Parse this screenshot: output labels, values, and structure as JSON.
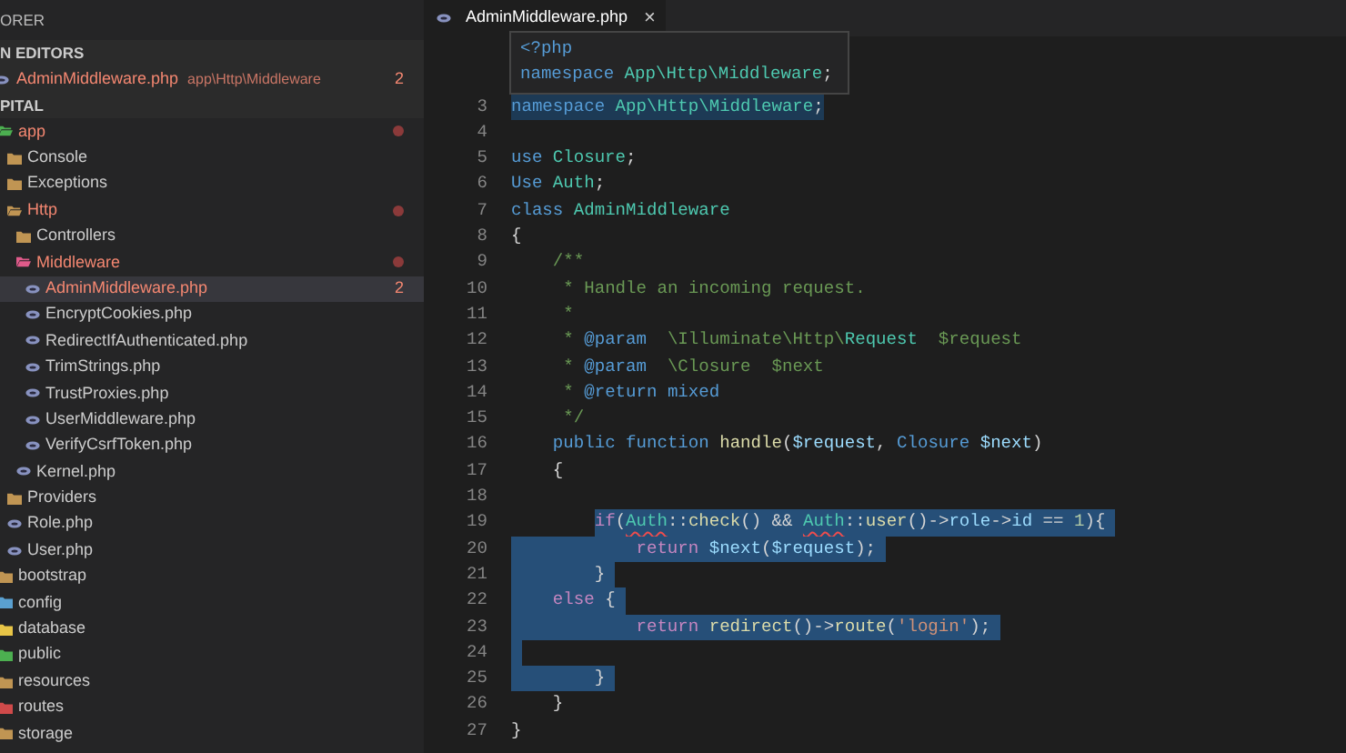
{
  "sidebar": {
    "header": "ORER",
    "open_editors": {
      "title": "N EDITORS",
      "items": [
        {
          "label": "AdminMiddleware.php",
          "path": "app\\Http\\Middleware",
          "badge": "2",
          "error": true
        }
      ]
    },
    "project": {
      "title": "PITAL",
      "tree": [
        {
          "label": "app",
          "kind": "folder",
          "color": "#4caf50",
          "expanded": true,
          "selected": false,
          "error": true,
          "dot": true,
          "children": [
            {
              "label": "Console",
              "kind": "folder",
              "color": "#c09553",
              "expanded": false,
              "selected": false,
              "error": false,
              "dot": false
            },
            {
              "label": "Exceptions",
              "kind": "folder",
              "color": "#c09553",
              "expanded": false,
              "selected": false,
              "error": false,
              "dot": false
            },
            {
              "label": "Http",
              "kind": "folder",
              "color": "#c09553",
              "expanded": true,
              "selected": false,
              "error": true,
              "dot": true,
              "children": [
                {
                  "label": "Controllers",
                  "kind": "folder",
                  "color": "#c09553",
                  "expanded": false,
                  "selected": false,
                  "error": false,
                  "dot": false
                },
                {
                  "label": "Middleware",
                  "kind": "folder",
                  "color": "#e05a8a",
                  "expanded": true,
                  "selected": false,
                  "error": true,
                  "dot": true,
                  "children": [
                    {
                      "label": "AdminMiddleware.php",
                      "kind": "file",
                      "selected": true,
                      "error": true,
                      "dot": false,
                      "badge": "2"
                    },
                    {
                      "label": "EncryptCookies.php",
                      "kind": "file",
                      "selected": false,
                      "error": false,
                      "dot": false
                    },
                    {
                      "label": "RedirectIfAuthenticated.php",
                      "kind": "file",
                      "selected": false,
                      "error": false,
                      "dot": false
                    },
                    {
                      "label": "TrimStrings.php",
                      "kind": "file",
                      "selected": false,
                      "error": false,
                      "dot": false
                    },
                    {
                      "label": "TrustProxies.php",
                      "kind": "file",
                      "selected": false,
                      "error": false,
                      "dot": false
                    },
                    {
                      "label": "UserMiddleware.php",
                      "kind": "file",
                      "selected": false,
                      "error": false,
                      "dot": false
                    },
                    {
                      "label": "VerifyCsrfToken.php",
                      "kind": "file",
                      "selected": false,
                      "error": false,
                      "dot": false
                    }
                  ]
                },
                {
                  "label": "Kernel.php",
                  "kind": "file",
                  "selected": false,
                  "error": false,
                  "dot": false
                }
              ]
            },
            {
              "label": "Providers",
              "kind": "folder",
              "color": "#c09553",
              "expanded": false,
              "selected": false,
              "error": false,
              "dot": false
            },
            {
              "label": "Role.php",
              "kind": "file",
              "selected": false,
              "error": false,
              "dot": false
            },
            {
              "label": "User.php",
              "kind": "file",
              "selected": false,
              "error": false,
              "dot": false
            }
          ]
        },
        {
          "label": "bootstrap",
          "kind": "folder",
          "color": "#c09553",
          "expanded": false,
          "selected": false,
          "error": false,
          "dot": false
        },
        {
          "label": "config",
          "kind": "folder",
          "color": "#5aa0d0",
          "expanded": false,
          "selected": false,
          "error": false,
          "dot": false
        },
        {
          "label": "database",
          "kind": "folder",
          "color": "#e8c547",
          "expanded": false,
          "selected": false,
          "error": false,
          "dot": false
        },
        {
          "label": "public",
          "kind": "folder",
          "color": "#4caf50",
          "expanded": false,
          "selected": false,
          "error": false,
          "dot": false
        },
        {
          "label": "resources",
          "kind": "folder",
          "color": "#c09553",
          "expanded": false,
          "selected": false,
          "error": false,
          "dot": false
        },
        {
          "label": "routes",
          "kind": "folder",
          "color": "#d04a4a",
          "expanded": false,
          "selected": false,
          "error": false,
          "dot": false
        },
        {
          "label": "storage",
          "kind": "folder",
          "color": "#c09553",
          "expanded": false,
          "selected": false,
          "error": false,
          "dot": false
        }
      ]
    }
  },
  "editor": {
    "tabs": [
      {
        "label": "AdminMiddleware.php",
        "close": "×",
        "selected": true
      }
    ],
    "hover": {
      "lines": [
        [
          {
            "kind": "keyword",
            "text": "<?php"
          }
        ],
        [
          {
            "kind": "keyword",
            "text": "namespace"
          },
          {
            "kind": "type",
            "text": " App\\Http\\Middleware"
          },
          {
            "kind": "plain",
            "text": ";"
          }
        ]
      ]
    },
    "lines": [
      {
        "number": "3",
        "highlighted": true,
        "selected": false,
        "tokens": [
          {
            "kind": "keyword",
            "text": "namespace"
          },
          {
            "kind": "type",
            "text": " App\\Http\\Middleware"
          },
          {
            "kind": "plain",
            "text": ";"
          }
        ]
      },
      {
        "number": "4",
        "highlighted": false,
        "selected": false
      },
      {
        "number": "5",
        "highlighted": false,
        "selected": false,
        "tokens": [
          {
            "kind": "keyword",
            "text": "use"
          },
          {
            "kind": "type",
            "text": " Closure"
          },
          {
            "kind": "plain",
            "text": ";"
          }
        ]
      },
      {
        "number": "6",
        "highlighted": false,
        "selected": false,
        "tokens": [
          {
            "kind": "keyword",
            "text": "Use"
          },
          {
            "kind": "type",
            "text": " Auth"
          },
          {
            "kind": "plain",
            "text": ";"
          }
        ]
      },
      {
        "number": "7",
        "highlighted": false,
        "selected": false,
        "tokens": [
          {
            "kind": "keyword",
            "text": "class"
          },
          {
            "kind": "type",
            "text": " AdminMiddleware"
          }
        ]
      },
      {
        "number": "8",
        "highlighted": false,
        "selected": false,
        "tokens": [
          {
            "kind": "plain",
            "text": "{"
          }
        ]
      },
      {
        "number": "9",
        "highlighted": false,
        "selected": false,
        "tokens": [
          {
            "kind": "comment",
            "text": "    /**"
          }
        ]
      },
      {
        "number": "10",
        "highlighted": false,
        "selected": false,
        "tokens": [
          {
            "kind": "comment",
            "text": "     * Handle an incoming request."
          }
        ]
      },
      {
        "number": "11",
        "highlighted": false,
        "selected": false,
        "tokens": [
          {
            "kind": "comment",
            "text": "     *"
          }
        ]
      },
      {
        "number": "12",
        "highlighted": false,
        "selected": false,
        "tokens": [
          {
            "kind": "comment",
            "text": "     *"
          },
          {
            "kind": "keyword",
            "text": " @param"
          },
          {
            "kind": "comment",
            "text": "  \\Illuminate\\Http\\"
          },
          {
            "kind": "type",
            "text": "Request"
          },
          {
            "kind": "comment",
            "text": "  $request"
          }
        ]
      },
      {
        "number": "13",
        "highlighted": false,
        "selected": false,
        "tokens": [
          {
            "kind": "comment",
            "text": "     *"
          },
          {
            "kind": "keyword",
            "text": " @param"
          },
          {
            "kind": "comment",
            "text": "  \\Closure  $next"
          }
        ]
      },
      {
        "number": "14",
        "highlighted": false,
        "selected": false,
        "tokens": [
          {
            "kind": "comment",
            "text": "     *"
          },
          {
            "kind": "keyword",
            "text": " @return mixed"
          }
        ]
      },
      {
        "number": "15",
        "highlighted": false,
        "selected": false,
        "tokens": [
          {
            "kind": "comment",
            "text": "     */"
          }
        ]
      },
      {
        "number": "16",
        "highlighted": false,
        "selected": false,
        "tokens": [
          {
            "kind": "keyword",
            "text": "    public function"
          },
          {
            "kind": "function",
            "text": " handle"
          },
          {
            "kind": "plain",
            "text": "("
          },
          {
            "kind": "variable",
            "text": "$request"
          },
          {
            "kind": "plain",
            "text": ","
          },
          {
            "kind": "keyword",
            "text": " Closure"
          },
          {
            "kind": "variable",
            "text": " $next"
          },
          {
            "kind": "plain",
            "text": ")"
          }
        ]
      },
      {
        "number": "17",
        "highlighted": false,
        "selected": false,
        "tokens": [
          {
            "kind": "plain",
            "text": "    {"
          }
        ]
      },
      {
        "number": "18",
        "highlighted": false,
        "selected": false
      },
      {
        "number": "19",
        "highlighted": false,
        "selected": true,
        "indent_selected": false,
        "tokens": [
          {
            "kind": "control",
            "text": "        if"
          },
          {
            "kind": "plain",
            "text": "("
          },
          {
            "kind": "type",
            "text": "Auth",
            "squiggle": true
          },
          {
            "kind": "plain",
            "text": "::"
          },
          {
            "kind": "function",
            "text": "check"
          },
          {
            "kind": "plain",
            "text": "() && "
          },
          {
            "kind": "type",
            "text": "Auth",
            "squiggle": true
          },
          {
            "kind": "plain",
            "text": "::"
          },
          {
            "kind": "function",
            "text": "user"
          },
          {
            "kind": "plain",
            "text": "()->"
          },
          {
            "kind": "variable",
            "text": "role"
          },
          {
            "kind": "plain",
            "text": "->"
          },
          {
            "kind": "variable",
            "text": "id"
          },
          {
            "kind": "plain",
            "text": " == "
          },
          {
            "kind": "number",
            "text": "1"
          },
          {
            "kind": "plain",
            "text": "){"
          }
        ]
      },
      {
        "number": "20",
        "highlighted": false,
        "selected": true,
        "indent_selected": true,
        "tokens": [
          {
            "kind": "control",
            "text": "            return"
          },
          {
            "kind": "variable",
            "text": " $next"
          },
          {
            "kind": "plain",
            "text": "("
          },
          {
            "kind": "variable",
            "text": "$request"
          },
          {
            "kind": "plain",
            "text": ");"
          }
        ]
      },
      {
        "number": "21",
        "highlighted": false,
        "selected": true,
        "indent_selected": true,
        "tokens": [
          {
            "kind": "plain",
            "text": "        }"
          }
        ]
      },
      {
        "number": "22",
        "highlighted": false,
        "selected": true,
        "indent_selected": true,
        "tokens": [
          {
            "kind": "control",
            "text": "    else"
          },
          {
            "kind": "plain",
            "text": " {"
          }
        ]
      },
      {
        "number": "23",
        "highlighted": false,
        "selected": true,
        "indent_selected": true,
        "tokens": [
          {
            "kind": "control",
            "text": "            return"
          },
          {
            "kind": "function",
            "text": " redirect"
          },
          {
            "kind": "plain",
            "text": "()->"
          },
          {
            "kind": "function",
            "text": "route"
          },
          {
            "kind": "plain",
            "text": "("
          },
          {
            "kind": "string",
            "text": "'login'"
          },
          {
            "kind": "plain",
            "text": ");"
          }
        ]
      },
      {
        "number": "24",
        "highlighted": false,
        "selected": true,
        "indent_selected": true
      },
      {
        "number": "25",
        "highlighted": false,
        "selected": true,
        "indent_selected": true,
        "tokens": [
          {
            "kind": "plain",
            "text": "        }"
          }
        ]
      },
      {
        "number": "26",
        "highlighted": false,
        "selected": false,
        "tokens": [
          {
            "kind": "plain",
            "text": "    }"
          }
        ]
      },
      {
        "number": "27",
        "highlighted": false,
        "selected": false,
        "tokens": [
          {
            "kind": "plain",
            "text": "}"
          }
        ]
      }
    ]
  }
}
